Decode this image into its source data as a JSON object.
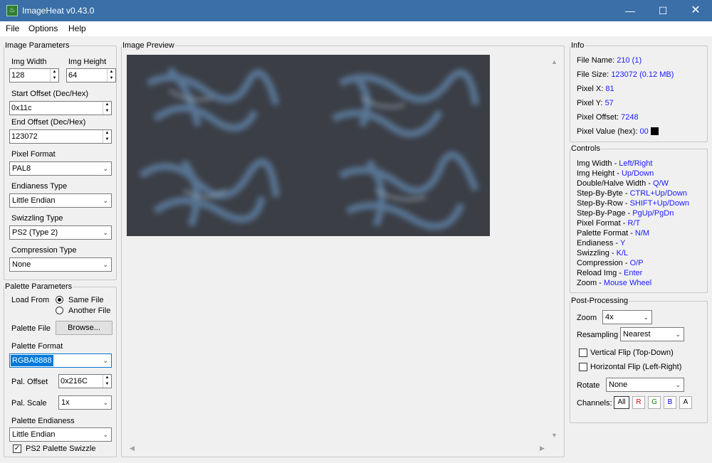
{
  "window": {
    "title": "ImageHeat v0.43.0"
  },
  "menu": [
    "File",
    "Options",
    "Help"
  ],
  "image_params": {
    "legend": "Image Parameters",
    "width_label": "Img Width",
    "width_value": "128",
    "height_label": "Img Height",
    "height_value": "64",
    "start_label": "Start Offset (Dec/Hex)",
    "start_value": "0x11c",
    "end_label": "End Offset (Dec/Hex)",
    "end_value": "123072",
    "pixel_format_label": "Pixel Format",
    "pixel_format_value": "PAL8",
    "endianess_label": "Endianess Type",
    "endianess_value": "Little Endian",
    "swizzling_label": "Swizzling Type",
    "swizzling_value": "PS2 (Type 2)",
    "compression_label": "Compression Type",
    "compression_value": "None"
  },
  "palette_params": {
    "legend": "Palette Parameters",
    "load_from_label": "Load From",
    "same_file": "Same File",
    "another_file": "Another File",
    "palette_file_label": "Palette File",
    "browse": "Browse...",
    "palette_format_label": "Palette Format",
    "palette_format_value": "RGBA8888",
    "offset_label": "Pal. Offset",
    "offset_value": "0x216C",
    "scale_label": "Pal. Scale",
    "scale_value": "1x",
    "endianess_label": "Palette Endianess",
    "endianess_value": "Little Endian",
    "ps2_swizzle": "PS2 Palette Swizzle"
  },
  "preview": {
    "legend": "Image Preview"
  },
  "info": {
    "legend": "Info",
    "file_name_label": "File Name:",
    "file_name": "210 (1)",
    "file_size_label": "File Size:",
    "file_size": "123072 (0.12 MB)",
    "pixel_x_label": "Pixel X:",
    "pixel_x": "81",
    "pixel_y_label": "Pixel Y:",
    "pixel_y": "57",
    "pixel_offset_label": "Pixel Offset:",
    "pixel_offset": "7248",
    "pixel_value_label": "Pixel Value (hex):",
    "pixel_value": "00",
    "pixel_color": "#000000"
  },
  "controls": {
    "legend": "Controls",
    "items": [
      {
        "label": "Img Width - ",
        "keys": "Left/Right"
      },
      {
        "label": "Img Height - ",
        "keys": "Up/Down"
      },
      {
        "label": "Double/Halve Width - ",
        "keys": "Q/W"
      },
      {
        "label": "Step-By-Byte - ",
        "keys": "CTRL+Up/Down"
      },
      {
        "label": "Step-By-Row - ",
        "keys": "SHIFT+Up/Down"
      },
      {
        "label": "Step-By-Page - ",
        "keys": "PgUp/PgDn"
      },
      {
        "label": "Pixel Format - ",
        "keys": "R/T"
      },
      {
        "label": "Palette Format - ",
        "keys": "N/M"
      },
      {
        "label": "Endianess - ",
        "keys": "Y"
      },
      {
        "label": "Swizzling - ",
        "keys": "K/L"
      },
      {
        "label": "Compression - ",
        "keys": "O/P"
      },
      {
        "label": "Reload Img - ",
        "keys": "Enter"
      },
      {
        "label": "Zoom - ",
        "keys": "Mouse Wheel"
      }
    ]
  },
  "post": {
    "legend": "Post-Processing",
    "zoom_label": "Zoom",
    "zoom_value": "4x",
    "resampling_label": "Resampling",
    "resampling_value": "Nearest",
    "vflip": "Vertical Flip (Top-Down)",
    "hflip": "Horizontal Flip (Left-Right)",
    "rotate_label": "Rotate",
    "rotate_value": "None",
    "channels_label": "Channels:",
    "channels": [
      "All",
      "R",
      "G",
      "B",
      "A"
    ]
  },
  "colors": {
    "accent": "#0078d7",
    "titlebar": "#3a6fa8",
    "key_blue": "#1a1aff"
  }
}
